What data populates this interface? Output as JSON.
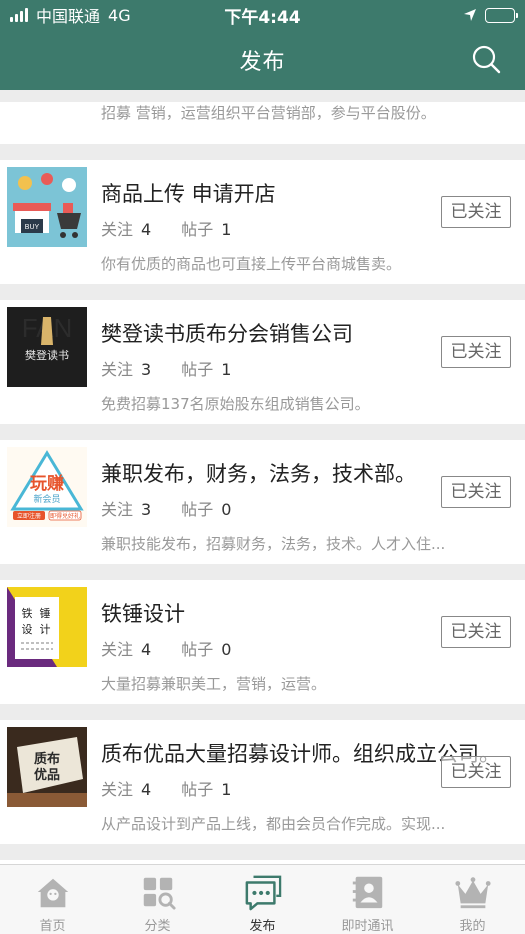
{
  "status_bar": {
    "carrier": "中国联通",
    "network": "4G",
    "time": "下午4:44"
  },
  "header": {
    "title": "发布"
  },
  "partial_top": {
    "desc": "招募  营销，运营组织平台营销部，参与平台股份。"
  },
  "posts": [
    {
      "title": "商品上传  申请开店",
      "follow_label": "关注",
      "follow_count": "4",
      "post_label": "帖子",
      "post_count": "1",
      "desc": "你有优质的商品也可直接上传平台商城售卖。",
      "button": "已关注"
    },
    {
      "title": "樊登读书质布分会销售公司",
      "follow_label": "关注",
      "follow_count": "3",
      "post_label": "帖子",
      "post_count": "1",
      "desc": "免费招募137名原始股东组成销售公司。",
      "button": "已关注"
    },
    {
      "title": "兼职发布，财务，法务，技术部。",
      "follow_label": "关注",
      "follow_count": "3",
      "post_label": "帖子",
      "post_count": "0",
      "desc": "兼职技能发布，招募财务，法务，技术。人才入住...",
      "button": "已关注"
    },
    {
      "title": "铁锤设计",
      "follow_label": "关注",
      "follow_count": "4",
      "post_label": "帖子",
      "post_count": "0",
      "desc": "大量招募兼职美工，营销，运营。",
      "button": "已关注"
    },
    {
      "title": "质布优品大量招募设计师。组织成立公司。",
      "follow_label": "关注",
      "follow_count": "4",
      "post_label": "帖子",
      "post_count": "1",
      "desc": "从产品设计到产品上线，都由会员合作完成。实现...",
      "button": "已关注"
    }
  ],
  "thumb_text": {
    "p1": "BUY",
    "p2": "樊登读书",
    "p3_main": "玩赚",
    "p3_sub": "新会员",
    "p3_left": "立即注册",
    "p3_right": "即得兑好礼",
    "p4_a": "铁",
    "p4_b": "锤",
    "p4_c": "设",
    "p4_d": "计",
    "p5_a": "质布",
    "p5_b": "优品"
  },
  "tabbar": {
    "items": [
      {
        "label": "首页",
        "icon": "home-icon"
      },
      {
        "label": "分类",
        "icon": "category-icon"
      },
      {
        "label": "发布",
        "icon": "chat-icon"
      },
      {
        "label": "即时通讯",
        "icon": "contacts-icon"
      },
      {
        "label": "我的",
        "icon": "crown-icon"
      }
    ],
    "active_index": 2
  },
  "colors": {
    "header": "#3d7a6c",
    "active_tab": "#3d7a6c",
    "inactive_tab": "#b3b3b3"
  }
}
